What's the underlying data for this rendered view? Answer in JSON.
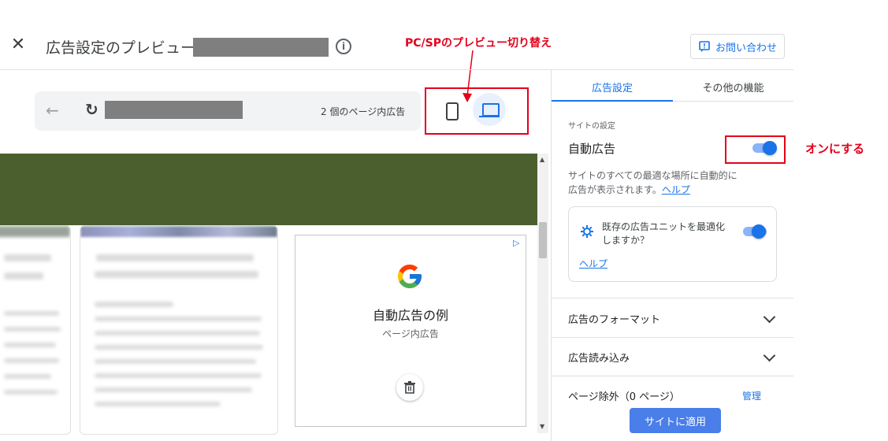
{
  "header": {
    "title": "広告設定のプレビュー",
    "contact_label": "お問い合わせ"
  },
  "annotations": {
    "device_switch": "PC/SPのプレビュー切り替え",
    "toggle_on": "オンにする"
  },
  "preview_toolbar": {
    "ad_count": "2 個のページ内広告"
  },
  "ad_preview": {
    "title": "自動広告の例",
    "subtitle": "ページ内広告",
    "badge": "▷"
  },
  "panel": {
    "tabs": [
      "広告設定",
      "その他の機能"
    ],
    "site_section_label": "サイトの設定",
    "auto_ads_label": "自動広告",
    "auto_ads_desc_1": "サイトのすべての最適な場所に自動的に",
    "auto_ads_desc_2": "広告が表示されます。",
    "help_label": "ヘルプ",
    "optimize_line_1": "既存の広告ユニットを最適化",
    "optimize_line_2": "しますか？",
    "optimize_help": "ヘルプ",
    "sections": [
      "広告のフォーマット",
      "広告読み込み"
    ],
    "page_exclusions": "ページ除外（0 ページ）",
    "manage_label": "管理",
    "apply_label": "サイトに適用"
  },
  "colors": {
    "accent": "#1a73e8",
    "annotation_red": "#e3001b",
    "banner_green": "#4b5f2e"
  },
  "icons": {
    "close": "close-icon",
    "info": "info-icon",
    "feedback": "feedback-icon",
    "back": "back-arrow-icon",
    "reload": "reload-icon",
    "phone": "phone-icon",
    "desktop": "desktop-icon",
    "trash": "trash-icon",
    "sparkle": "optimize-gear-icon"
  }
}
